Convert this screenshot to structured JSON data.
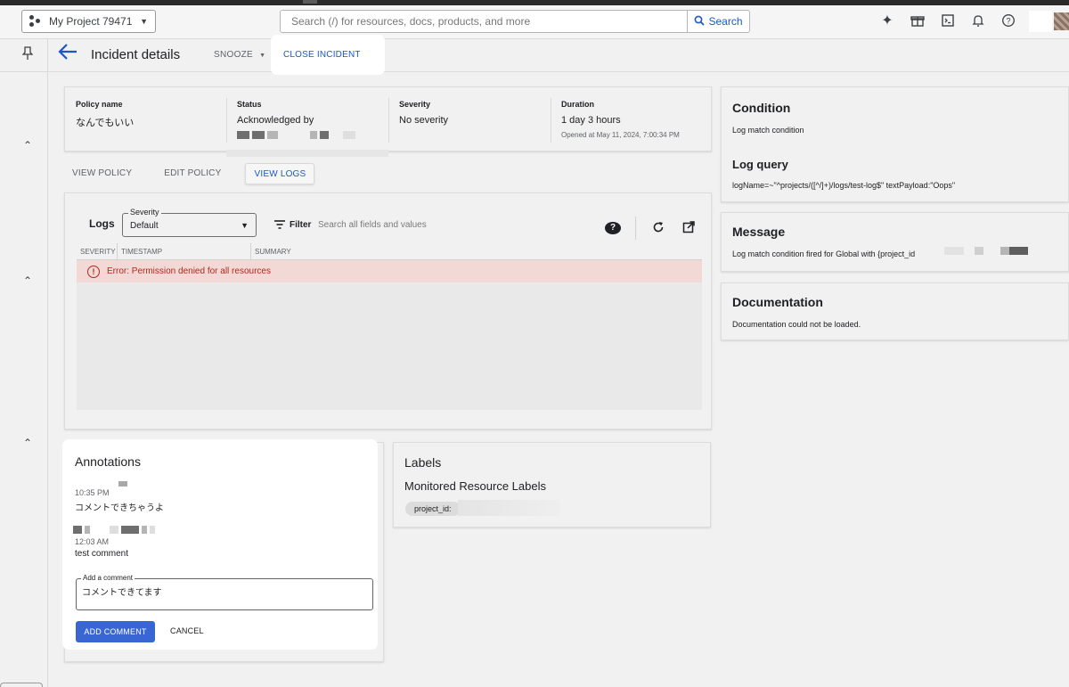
{
  "topbar": {
    "project_name": "My Project 79471",
    "search_placeholder": "Search (/) for resources, docs, products, and more",
    "search_button": "Search"
  },
  "header": {
    "title": "Incident details",
    "snooze_label": "SNOOZE",
    "close_incident_label": "CLOSE INCIDENT"
  },
  "summary": {
    "policy_name_label": "Policy name",
    "policy_name_value": "なんでもいい",
    "status_label": "Status",
    "status_value": "Acknowledged by",
    "severity_label": "Severity",
    "severity_value": "No severity",
    "duration_label": "Duration",
    "duration_value": "1 day 3 hours",
    "opened_at": "Opened at May 11, 2024, 7:00:34 PM"
  },
  "policy_tabs": [
    "VIEW POLICY",
    "EDIT POLICY",
    "VIEW LOGS"
  ],
  "logs": {
    "title": "Logs",
    "severity_legend": "Severity",
    "severity_value": "Default",
    "filter_label": "Filter",
    "filter_placeholder": "Search all fields and values",
    "columns": [
      "SEVERITY",
      "TIMESTAMP",
      "SUMMARY"
    ],
    "error_text": "Error: Permission denied for all resources"
  },
  "condition": {
    "title": "Condition",
    "text": "Log match condition",
    "log_query_title": "Log query",
    "log_query_text": "logName=~\"^projects/([^/]+)/logs/test-log$\" textPayload:\"Oops\""
  },
  "message": {
    "title": "Message",
    "text": "Log match condition fired for Global with {project_id"
  },
  "documentation": {
    "title": "Documentation",
    "text": "Documentation could not be loaded."
  },
  "annotations": {
    "title": "Annotations",
    "items": [
      {
        "time": "10:35 PM",
        "text": "コメントできちゃうよ"
      },
      {
        "time": "12:03 AM",
        "text": "test comment"
      }
    ],
    "comment_legend": "Add a comment",
    "comment_value": "コメントできてます",
    "add_button": "ADD COMMENT",
    "cancel_button": "CANCEL"
  },
  "labels": {
    "title": "Labels",
    "subtitle": "Monitored Resource Labels",
    "chip": "project_id: "
  },
  "colors": {
    "accent": "#1a57c8",
    "primary_button": "#3a66d4",
    "error_text": "#b3261e",
    "error_row": "#f2d9d6"
  }
}
